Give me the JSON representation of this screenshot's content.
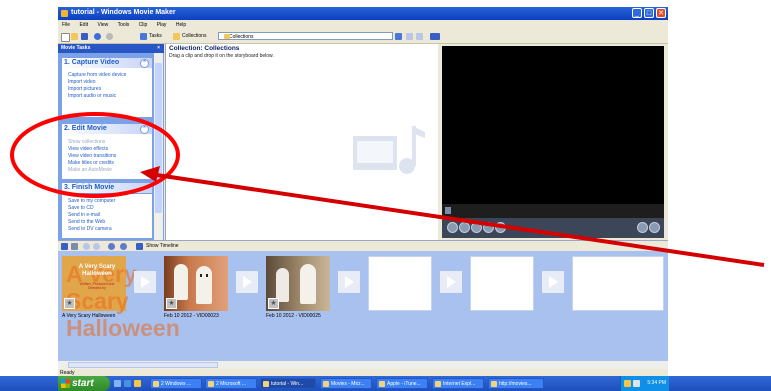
{
  "window": {
    "title": "tutorial - Windows Movie Maker"
  },
  "menu": [
    "File",
    "Edit",
    "View",
    "Tools",
    "Clip",
    "Play",
    "Help"
  ],
  "toolbar": {
    "tasks_label": "Tasks",
    "collections_label": "Collections",
    "collection_dropdown_value": "Collections"
  },
  "tasks_pane": {
    "header": "Movie Tasks",
    "close": "×",
    "sections": [
      {
        "title": "1. Capture Video",
        "links": [
          "Capture from video device",
          "Import video",
          "Import pictures",
          "Import audio or music"
        ]
      },
      {
        "title": "2. Edit Movie",
        "links": [
          "Show collections",
          "View video effects",
          "View video transitions",
          "Make titles or credits",
          "Make an AutoMovie"
        ],
        "disabled": [
          true,
          false,
          false,
          false,
          true
        ]
      },
      {
        "title": "3. Finish Movie",
        "links": [
          "Save to my computer",
          "Save to CD",
          "Send in e-mail",
          "Send to the Web",
          "Send to DV camera"
        ]
      }
    ]
  },
  "collection_pane": {
    "title": "Collection: Collections",
    "instruction": "Drag a clip and drop it on the storyboard below."
  },
  "storyboard": {
    "show_timeline_label": "Show Timeline",
    "clips": [
      {
        "label": "A Very Scary Halloween",
        "title_text": "A Very Scary Halloween",
        "caption": "Written, Produced and Directed by",
        "bg": "#e2a64a"
      },
      {
        "label": "Feb 10 2012 - VID00023",
        "bg": "#b7643a"
      },
      {
        "label": "Feb 10 2012 - VID00025",
        "bg": "#9c8a70"
      }
    ],
    "empty_slots": 3,
    "star_glyph": "★"
  },
  "status": {
    "text": "Ready"
  },
  "taskbar": {
    "start_label": "start",
    "buttons": [
      "2 Windows ...",
      "2 Microsoft ...",
      "tutorial - Win...",
      "Movies - Micr...",
      "Apple - iTune...",
      "Internet Expl...",
      "http://movies..."
    ],
    "clock": "5:34 PM"
  },
  "annotation": {
    "circle_color": "#ff0000",
    "arrow_color": "#d40000"
  },
  "icons": {
    "close": "✕",
    "minimize": "_",
    "maximize": "□",
    "chevron": "⌃"
  }
}
